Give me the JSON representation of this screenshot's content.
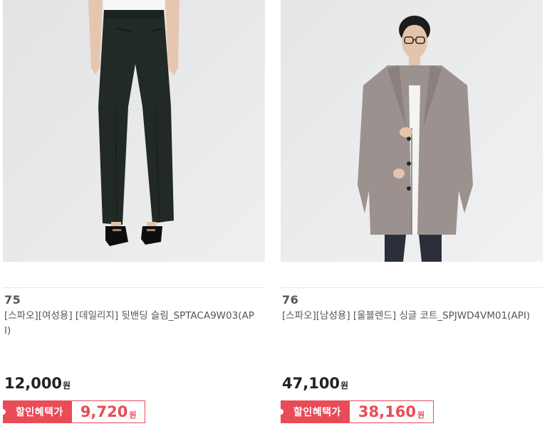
{
  "products": [
    {
      "rank": "75",
      "name": "[스파오][여성용] [데일리지] 뒷밴딩 슬림_SPTACA9W03(API)",
      "price": "12,000",
      "price_unit": "원",
      "benefit_label": "할인혜택가",
      "benefit_price": "9,720",
      "benefit_unit": "원",
      "image": "woman-black-slim-pants-photo"
    },
    {
      "rank": "76",
      "name": "[스파오][남성용] [울블렌드] 싱글 코트_SPJWD4VM01(API)",
      "price": "47,100",
      "price_unit": "원",
      "benefit_label": "할인혜택가",
      "benefit_price": "38,160",
      "benefit_unit": "원",
      "image": "man-grey-single-coat-photo"
    }
  ],
  "colors": {
    "accent": "#e94b57",
    "image_bg": "#e9eaec"
  }
}
